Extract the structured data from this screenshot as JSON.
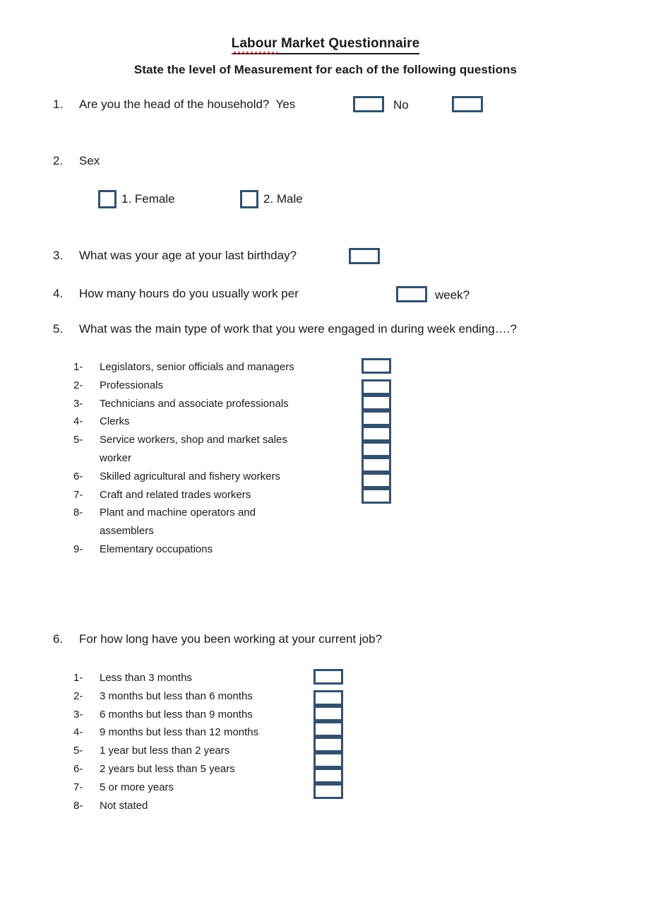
{
  "document": {
    "title_prefix": "Labour",
    "title_rest": " Market Questionnaire",
    "subtitle": "State the level of Measurement for each of the following questions",
    "box_border_color": "#33506f",
    "spellcheck_color": "#d93025"
  },
  "questions": [
    {
      "number": "1.",
      "text": "Are you the head of the household?  Yes",
      "answer_labels": {
        "yes": "Yes",
        "no": "No"
      }
    },
    {
      "number": "2.",
      "text": "Sex",
      "options": [
        {
          "label": "1. Female"
        },
        {
          "label": "2. Male"
        }
      ]
    },
    {
      "number": "3.",
      "text": "What was your age at your last birthday?"
    },
    {
      "number": "4.",
      "text": "How many hours do you usually work per",
      "suffix": "week?"
    },
    {
      "number": "5.",
      "text": "What was the main type of work that you were engaged in during week ending….?",
      "options": [
        {
          "num": "1-",
          "label": "Legislators, senior officials and managers"
        },
        {
          "num": "2-",
          "label": "Professionals"
        },
        {
          "num": "3-",
          "label": "Technicians and associate professionals"
        },
        {
          "num": "4-",
          "label": "Clerks"
        },
        {
          "num": "5-",
          "label": "Service workers, shop and market sales worker"
        },
        {
          "num": "6-",
          "label": "Skilled agricultural and fishery workers"
        },
        {
          "num": "7-",
          "label": "Craft and related trades workers"
        },
        {
          "num": "8-",
          "label": "Plant and machine operators and assemblers"
        },
        {
          "num": "9-",
          "label": "Elementary occupations"
        }
      ],
      "box_count": 9
    },
    {
      "number": "6.",
      "text": "For how long have you been working at your current job?",
      "options": [
        {
          "num": "1-",
          "label": "Less than 3 months"
        },
        {
          "num": "2-",
          "label": "3 months but less than 6 months"
        },
        {
          "num": "3-",
          "label": "6 months but less than 9 months"
        },
        {
          "num": "4-",
          "label": "9 months but less than 12 months"
        },
        {
          "num": "5-",
          "label": "1 year but less than 2 years"
        },
        {
          "num": "6-",
          "label": "2 years but less than 5 years"
        },
        {
          "num": "7-",
          "label": "5 or more years"
        },
        {
          "num": "8-",
          "label": "Not stated"
        }
      ],
      "box_count": 8
    }
  ]
}
